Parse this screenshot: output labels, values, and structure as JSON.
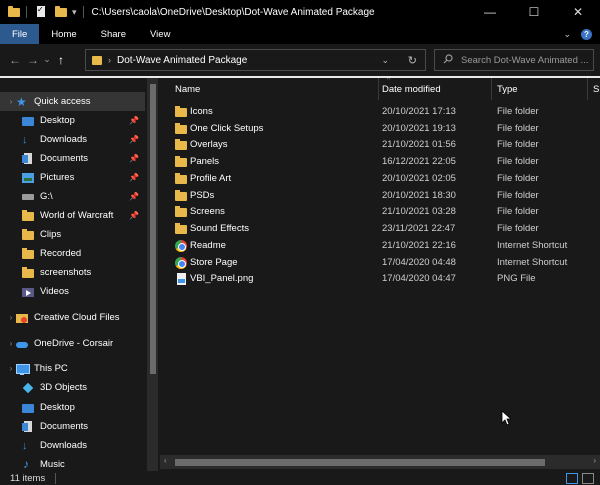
{
  "titlebar": {
    "path": "C:\\Users\\caola\\OneDrive\\Desktop\\Dot-Wave Animated Package",
    "minimize": "—",
    "maximize": "☐",
    "close": "✕"
  },
  "ribbon": {
    "tabs": [
      {
        "label": "File",
        "active": true
      },
      {
        "label": "Home",
        "active": false
      },
      {
        "label": "Share",
        "active": false
      },
      {
        "label": "View",
        "active": false
      }
    ],
    "expand": "⌄",
    "help": "?"
  },
  "navigation": {
    "back": "←",
    "forward": "→",
    "recent": "⌄",
    "up": "↑",
    "address": "Dot-Wave Animated Package",
    "address_separator": "›",
    "refresh": "↻",
    "dropdown": "⌄",
    "search_placeholder": "Search Dot-Wave Animated ..."
  },
  "sidebar": {
    "items": [
      {
        "label": "Quick access",
        "icon": "star-icon",
        "pinned": false,
        "selected": true,
        "chevron": "›"
      },
      {
        "label": "Desktop",
        "icon": "desktop-icon",
        "pinned": true
      },
      {
        "label": "Downloads",
        "icon": "downloads-icon",
        "pinned": true
      },
      {
        "label": "Documents",
        "icon": "documents-icon",
        "pinned": true
      },
      {
        "label": "Pictures",
        "icon": "pictures-icon",
        "pinned": true
      },
      {
        "label": "G:\\",
        "icon": "drive-icon",
        "pinned": true
      },
      {
        "label": "World of Warcraft",
        "icon": "folder-icon",
        "pinned": true
      },
      {
        "label": "Clips",
        "icon": "folder-icon",
        "pinned": false
      },
      {
        "label": "Recorded",
        "icon": "folder-icon",
        "pinned": false
      },
      {
        "label": "screenshots",
        "icon": "folder-icon",
        "pinned": false
      },
      {
        "label": "Videos",
        "icon": "videos-icon",
        "pinned": false
      },
      {
        "label": "Creative Cloud Files",
        "icon": "creative-cloud-icon",
        "pinned": false,
        "chevron": "›"
      },
      {
        "label": "OneDrive - Corsair",
        "icon": "onedrive-icon",
        "pinned": false,
        "chevron": "›"
      },
      {
        "label": "This PC",
        "icon": "this-pc-icon",
        "pinned": false,
        "chevron": "›"
      },
      {
        "label": "3D Objects",
        "icon": "3d-objects-icon",
        "pinned": false
      },
      {
        "label": "Desktop",
        "icon": "desktop-icon",
        "pinned": false
      },
      {
        "label": "Documents",
        "icon": "documents-icon",
        "pinned": false
      },
      {
        "label": "Downloads",
        "icon": "downloads-icon",
        "pinned": false
      },
      {
        "label": "Music",
        "icon": "music-icon",
        "pinned": false
      }
    ],
    "pin_glyph": "📌"
  },
  "filelist": {
    "columns": [
      {
        "label": "Name"
      },
      {
        "label": "Date modified"
      },
      {
        "label": "Type"
      },
      {
        "label": "Si"
      }
    ],
    "sort_glyph": "^",
    "rows": [
      {
        "name": "Icons",
        "date": "20/10/2021 17:13",
        "type": "File folder",
        "icon": "folder"
      },
      {
        "name": "One Click Setups",
        "date": "20/10/2021 19:13",
        "type": "File folder",
        "icon": "folder"
      },
      {
        "name": "Overlays",
        "date": "21/10/2021 01:56",
        "type": "File folder",
        "icon": "folder"
      },
      {
        "name": "Panels",
        "date": "16/12/2021 22:05",
        "type": "File folder",
        "icon": "folder"
      },
      {
        "name": "Profile Art",
        "date": "20/10/2021 02:05",
        "type": "File folder",
        "icon": "folder"
      },
      {
        "name": "PSDs",
        "date": "20/10/2021 18:30",
        "type": "File folder",
        "icon": "folder"
      },
      {
        "name": "Screens",
        "date": "21/10/2021 03:28",
        "type": "File folder",
        "icon": "folder"
      },
      {
        "name": "Sound Effects",
        "date": "23/11/2021 22:47",
        "type": "File folder",
        "icon": "folder"
      },
      {
        "name": "Readme",
        "date": "21/10/2021 22:16",
        "type": "Internet Shortcut",
        "icon": "link"
      },
      {
        "name": "Store Page",
        "date": "17/04/2020 04:48",
        "type": "Internet Shortcut",
        "icon": "link"
      },
      {
        "name": "VBI_Panel.png",
        "date": "17/04/2020 04:47",
        "type": "PNG File",
        "icon": "png"
      }
    ]
  },
  "hscroll": {
    "left": "‹",
    "right": "›"
  },
  "status": {
    "count": "11 items"
  },
  "colors": {
    "accent": "#2c5a8e",
    "background": "#191919",
    "folder": "#e8b84a"
  }
}
